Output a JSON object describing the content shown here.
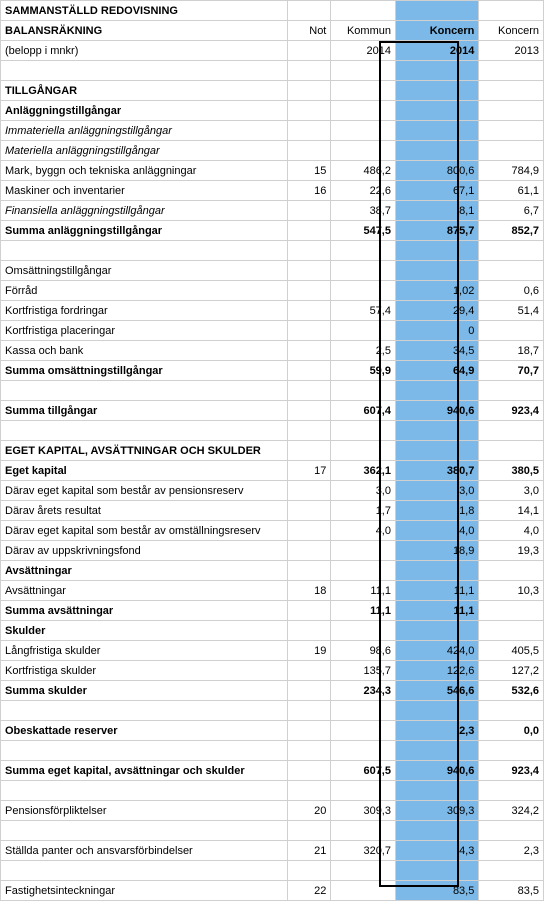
{
  "header": {
    "title1": "SAMMANSTÄLLD REDOVISNING",
    "title2": "BALANSRÄKNING",
    "sub": "(belopp i mnkr)",
    "colNot": "Not",
    "colKommun": "Kommun",
    "colKoncern1": "Koncern",
    "colKoncern2": "Koncern",
    "yKommun": "2014",
    "yKoncern1": "2014",
    "yKoncern2": "2013"
  },
  "sections": {
    "tillgangar": "TILLGÅNGAR",
    "anl": "Anläggningstillgångar",
    "immat": "Immateriella anläggningstillgångar",
    "mat": "Materiella anläggningstillgångar",
    "finans": "Finansiella anläggningstillgångar",
    "sumAnl": "Summa anläggningstillgångar",
    "oms": "Omsättningstillgångar",
    "sumOms": "Summa omsättningstillgångar",
    "sumTill": "Summa tillgångar",
    "eget": "EGET KAPITAL, AVSÄTTNINGAR OCH SKULDER",
    "egetKap": "Eget kapital",
    "avs": "Avsättningar",
    "sumAvs": "Summa avsättningar",
    "skulder": "Skulder",
    "sumSkuld": "Summa skulder",
    "obesk": "Obeskattade reserver",
    "sumEget": "Summa eget kapital, avsättningar och skulder"
  },
  "rows": {
    "mark": {
      "label": "Mark, byggn och tekniska anläggningar",
      "not": "15",
      "kom": "486,2",
      "k1": "800,6",
      "k2": "784,9"
    },
    "mask": {
      "label": "Maskiner och inventarier",
      "not": "16",
      "kom": "22,6",
      "k1": "67,1",
      "k2": "61,1"
    },
    "fin": {
      "kom": "38,7",
      "k1": "8,1",
      "k2": "6,7"
    },
    "sumAnl": {
      "kom": "547,5",
      "k1": "875,7",
      "k2": "852,7"
    },
    "forrad": {
      "label": "Förråd",
      "k1": "1,02",
      "k2": "0,6"
    },
    "kfFor": {
      "label": "Kortfristiga fordringar",
      "kom": "57,4",
      "k1": "29,4",
      "k2": "51,4"
    },
    "kfPla": {
      "label": "Kortfristiga placeringar",
      "k1": "0"
    },
    "kassa": {
      "label": "Kassa och bank",
      "kom": "2,5",
      "k1": "34,5",
      "k2": "18,7"
    },
    "sumOms": {
      "kom": "59,9",
      "k1": "64,9",
      "k2": "70,7"
    },
    "sumTill": {
      "kom": "607,4",
      "k1": "940,6",
      "k2": "923,4"
    },
    "egetK": {
      "not": "17",
      "kom": "362,1",
      "k1": "380,7",
      "k2": "380,5"
    },
    "pensRes": {
      "label": "Därav eget kapital som består av pensionsreserv",
      "kom": "3,0",
      "k1": "3,0",
      "k2": "3,0"
    },
    "aretsRes": {
      "label": "Därav årets resultat",
      "kom": "1,7",
      "k1": "1,8",
      "k2": "14,1"
    },
    "omRes": {
      "label": "Därav eget kapital som består av omställningsreserv",
      "kom": "4,0",
      "k1": "4,0",
      "k2": "4,0"
    },
    "uppskr": {
      "label": "Därav av uppskrivningsfond",
      "k1": "18,9",
      "k2": "19,3"
    },
    "avsRow": {
      "label": "Avsättningar",
      "not": "18",
      "kom": "11,1",
      "k1": "11,1",
      "k2": "10,3"
    },
    "sumAvs": {
      "kom": "11,1",
      "k1": "11,1"
    },
    "langSk": {
      "label": "Långfristiga skulder",
      "not": "19",
      "kom": "98,6",
      "k1": "424,0",
      "k2": "405,5"
    },
    "kortSk": {
      "label": "Kortfristiga skulder",
      "kom": "135,7",
      "k1": "122,6",
      "k2": "127,2"
    },
    "sumSk": {
      "kom": "234,3",
      "k1": "546,6",
      "k2": "532,6"
    },
    "obesk": {
      "k1": "2,3",
      "k2": "0,0"
    },
    "sumEget": {
      "kom": "607,5",
      "k1": "940,6",
      "k2": "923,4"
    },
    "pensF": {
      "label": "Pensionsförpliktelser",
      "not": "20",
      "kom": "309,3",
      "k1": "309,3",
      "k2": "324,2"
    },
    "stPant": {
      "label": "Ställda panter och ansvarsförbindelser",
      "not": "21",
      "kom": "320,7",
      "k1": "4,3",
      "k2": "2,3"
    },
    "fastInt": {
      "label": "Fastighetsinteckningar",
      "not": "22",
      "k1": "83,5",
      "k2": "83,5"
    }
  }
}
